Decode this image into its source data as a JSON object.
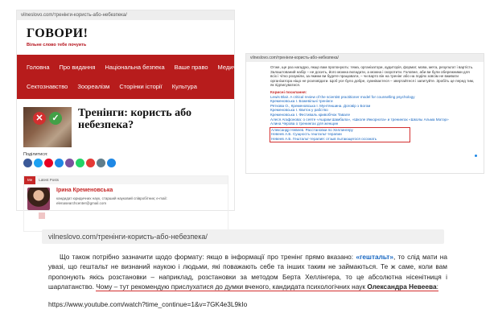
{
  "shot_a": {
    "url": "vilneslovo.com/тренінги-користь-або-небезпека/",
    "brand": "ГОВОРИ!",
    "tagline": "Вільне слово тебе почуить",
    "nav_row1": [
      "Головна",
      "Про видання",
      "Національна безпека",
      "Ваше право",
      "Медична"
    ],
    "nav_row2": [
      "Сектознавство",
      "Зоореалізм",
      "Сторінки історії",
      "Культура"
    ],
    "post_title": "Тренінги: користь або небезпека?",
    "share_label": "Поділитися:",
    "share_colors": [
      "#3b5998",
      "#1da1f2",
      "#e60023",
      "#1e88e5",
      "#7b519d",
      "#25d366",
      "#e53935",
      "#607d8b",
      "#1e88e5"
    ],
    "author_tabs": [
      "Me",
      "Latest Posts"
    ],
    "author_name": "Ірина Кременовська",
    "author_desc": "кандидат юридичних наук, старший науковий співробітник; e-mail: elenasearchcenter@gmail.com"
  },
  "shot_b": {
    "url": "vilneslovo.com/тренінги-користь-або-небезпека/",
    "intro": "Отже, ще раз нагадую, якщо вам пропонують: тема, організатори, аудиторія, формат, мова, мета, результат і вартість. Залаштований набір – не досить, його можна вкладати, а можна і скоротити. Головне, аби ви були обережними для всіх і чітко розуміли, за якими ви будете працювати, – чи варто він на тренінг або на подіях зовсім не вживати організатора ніщо не розповідати. Щоб усе було добре, сумніваєтеся – звертайтеся і запитуйте. Зробіть це перед тим, як підписуватися.",
    "sources_head": "Корисні посилання:",
    "refs": [
      "Lewis Blair. A critical review of the scientist practitioner model for counselling psychology",
      "Кременовська І. Божевільні тренінги",
      "Ряткова О., Кременовська І. Мунтяншина. Договір з Богом",
      "Кременовська І. Квиток у рабство",
      "Кременовська І. Фестиваль кривобічок Тавале",
      "Алеся Агафонова: о сеяте «Ашрам Шамбала», «Школе Инкорнэта» и тренингах «Школы Альма Матэр»",
      "Алина Черова о тренингах для женщин"
    ],
    "boxed_refs": [
      "Александр Невеев. Расстановки по Хеллингеру",
      "Невеев А.Б. Сущность гештальт-терапии",
      "Невеев А.Б. Гештальт-терапия: отзыв пытающегося осознать"
    ]
  },
  "shot_c": {
    "url": "vilneslovo.com/тренінги-користь-або-небезпека/",
    "p1": "Що також потрібно зазначити щодо формату: якщо в інформації про тренінг прямо вказано: ",
    "keyword": "«гештальт»",
    "p2": ", то слід мати на увазі, що гештальт не визнаний наукою і людьми, які поважають себе та інших таким не займаються. Те ж саме, коли вам пропонують якісь розстановки – наприклад, розстановки за методом Берта Хеллінгера, то це абсолютна нісенітниця і шарлатанство. ",
    "p3_highlight": "Чому – тут рекомендую прислухатися до думки вченого, кандидата психологічних наук ",
    "expert": "Олександра Невеева",
    "p4": ":",
    "youtube": "https://www.youtube.com/watch?time_continue=1&v=7GK4e3L9kIo"
  }
}
